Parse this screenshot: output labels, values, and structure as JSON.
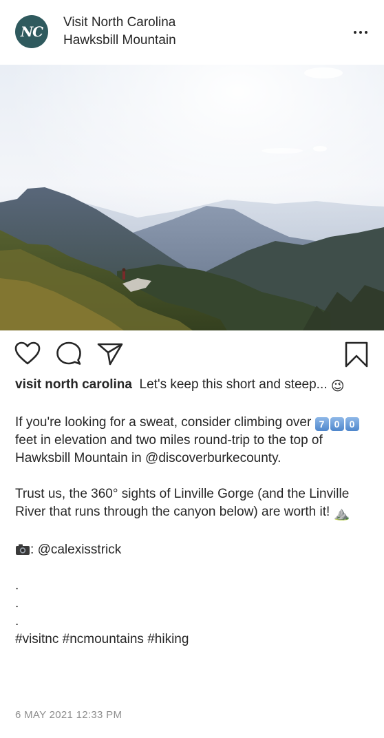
{
  "post": {
    "account_name": "Visit North Carolina",
    "location": "Hawksbill Mountain",
    "avatar_text": "NC",
    "icons": {
      "more": "more-options-icon",
      "like": "heart-icon",
      "comment": "comment-icon",
      "share": "send-icon",
      "save": "bookmark-icon",
      "camera": "camera-emoji"
    },
    "image": {
      "subject": "Mountain landscape photo"
    },
    "caption": {
      "username": "visit north carolina",
      "line1": "Let's keep this short and steep...",
      "line1_emoji": "😉",
      "para2_before": "If you're looking for a sweat, consider climbing over",
      "number_keycaps": [
        "7",
        "0",
        "0"
      ],
      "para2_after": "feet in elevation and two miles round-trip to the top of Hawksbill Mountain in",
      "para2_mention": "@discoverburkecounty.",
      "para3": "Trust us, the 360° sights of Linville Gorge (and the Linville River that runs through the canyon below) are worth it!",
      "para3_emoji": "⛰️",
      "credit_suffix": ":",
      "credit_mention": "@calexisstrick",
      "dots": [
        ".",
        ".",
        "."
      ],
      "hashtags": [
        "#visitnc",
        "#ncmountains",
        "#hiking"
      ]
    },
    "timestamp": "6 MAY 2021 12:33 PM"
  },
  "colors": {
    "avatar_bg": "#2f5a5e",
    "text": "#262626",
    "muted": "#8e8e8e"
  }
}
